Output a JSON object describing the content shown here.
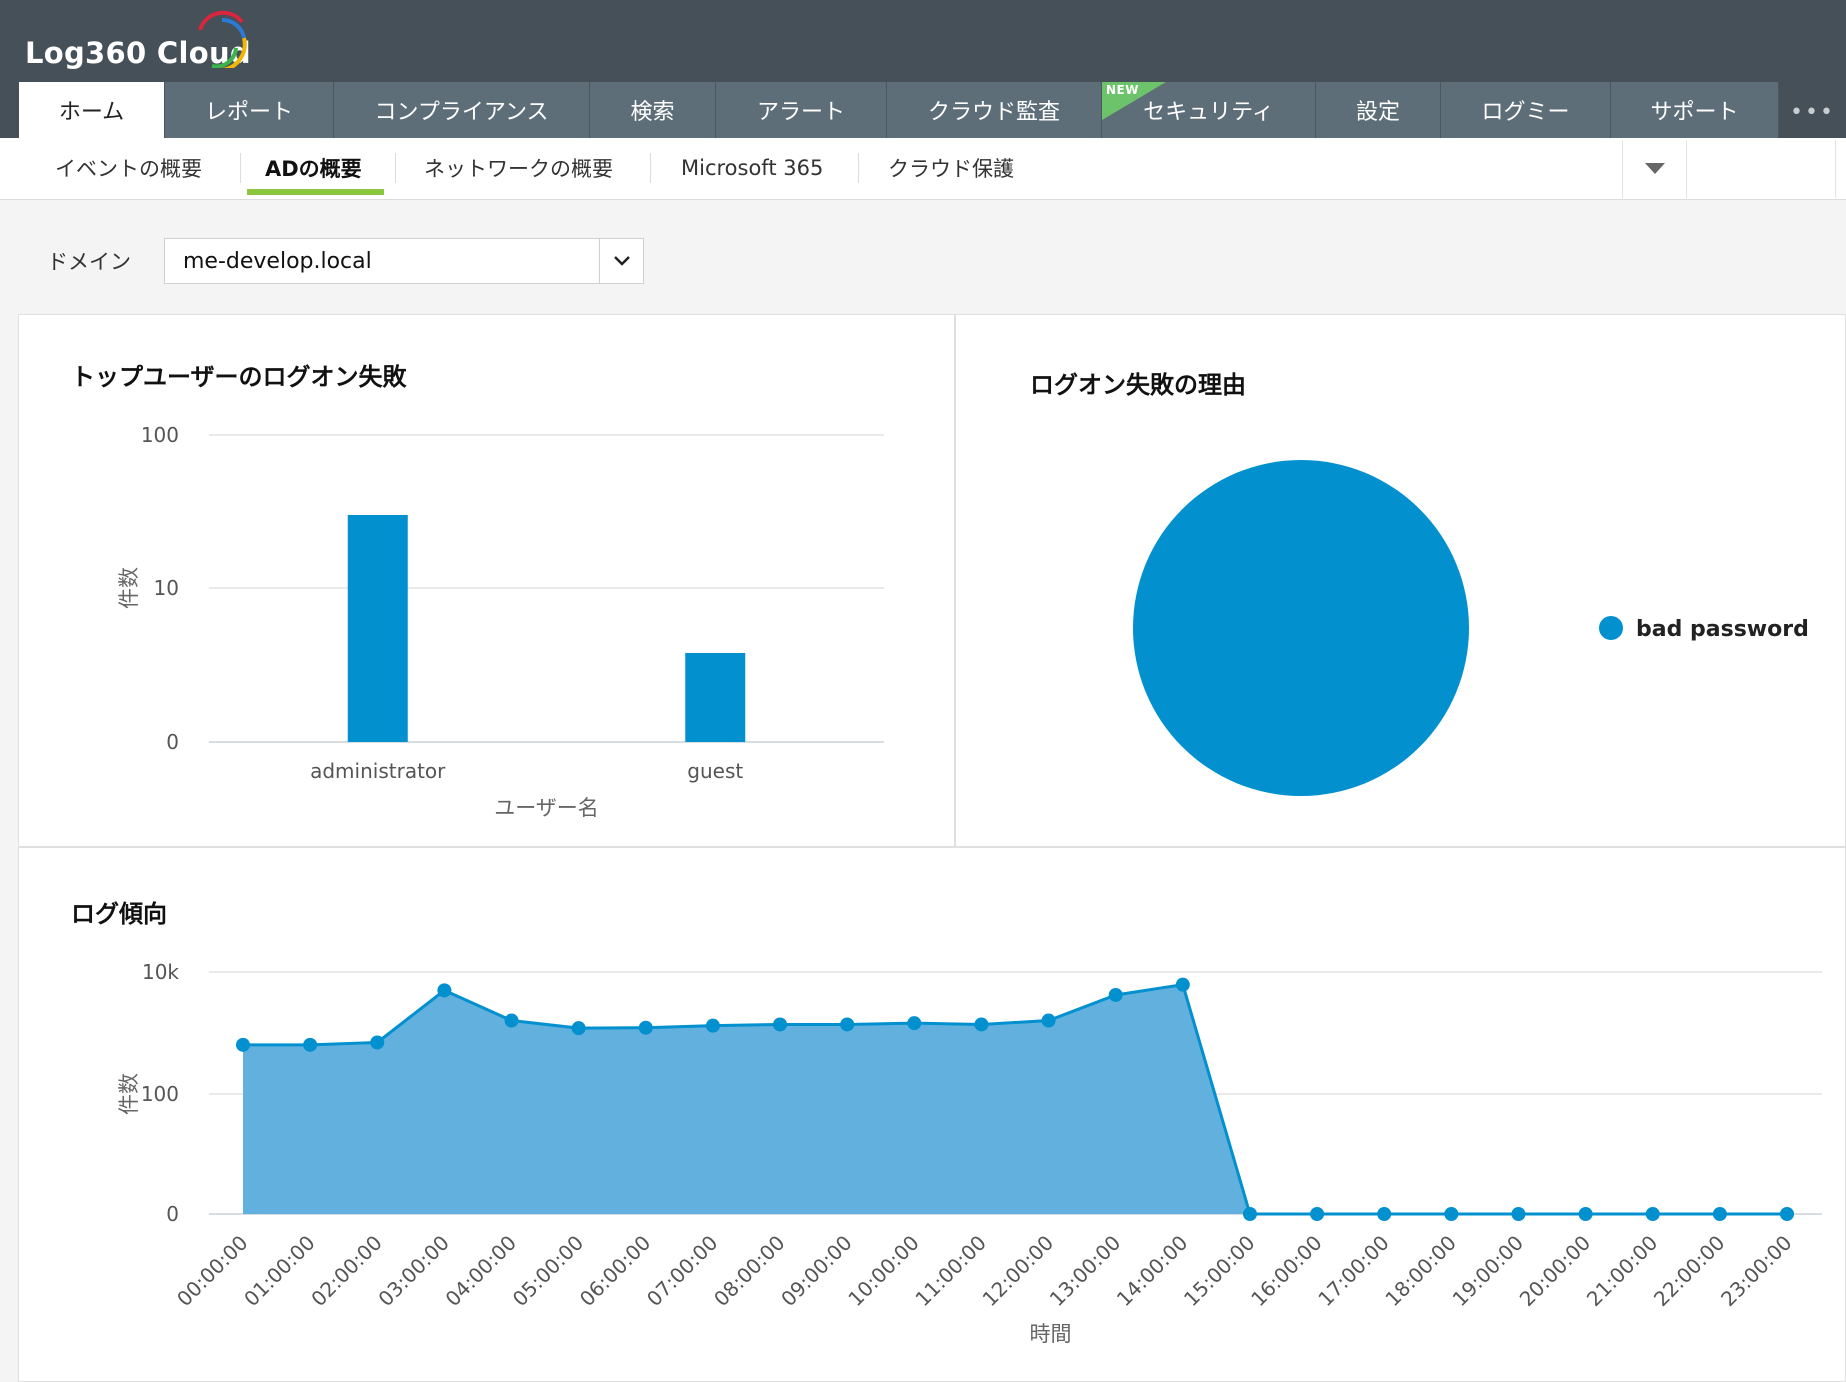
{
  "app": {
    "logo_text": "Log360 Cloud"
  },
  "nav": {
    "tabs": [
      {
        "label": "ホーム",
        "active": true
      },
      {
        "label": "レポート"
      },
      {
        "label": "コンプライアンス"
      },
      {
        "label": "検索"
      },
      {
        "label": "アラート"
      },
      {
        "label": "クラウド監査"
      },
      {
        "label": "セキュリティ",
        "badge": "NEW"
      },
      {
        "label": "設定"
      },
      {
        "label": "ログミー"
      },
      {
        "label": "サポート"
      }
    ],
    "more_icon": "•••"
  },
  "subnav": {
    "items": [
      {
        "label": "イベントの概要"
      },
      {
        "label": "ADの概要",
        "active": true
      },
      {
        "label": "ネットワークの概要"
      },
      {
        "label": "Microsoft 365"
      },
      {
        "label": "クラウド保護"
      }
    ]
  },
  "filter": {
    "label": "ドメイン",
    "value": "me-develop.local"
  },
  "panels": {
    "top_users": {
      "title": "トップユーザーのログオン失敗"
    },
    "reasons": {
      "title": "ログオン失敗の理由"
    },
    "trend": {
      "title": "ログ傾向"
    }
  },
  "colors": {
    "accent": "#0290cf",
    "area_fill": "#5aacdc",
    "tab_bg": "#5e6e79",
    "header_bg": "#455059",
    "active_underline": "#8cc63f",
    "badge_green": "#6cc36a"
  },
  "chart_data": [
    {
      "type": "bar",
      "title": "トップユーザーのログオン失敗",
      "xlabel": "ユーザー名",
      "ylabel": "件数",
      "yscale": "log",
      "yticks": [
        "0",
        "10",
        "100"
      ],
      "categories": [
        "administrator",
        "guest"
      ],
      "values": [
        30,
        3
      ],
      "grid": true
    },
    {
      "type": "pie",
      "title": "ログオン失敗の理由",
      "labels": [
        "bad password"
      ],
      "values": [
        100
      ],
      "legend": "right"
    },
    {
      "type": "area",
      "title": "ログ傾向",
      "xlabel": "時間",
      "ylabel": "件数",
      "yscale": "log",
      "yticks": [
        "0",
        "100",
        "10k"
      ],
      "x": [
        "00:00:00",
        "01:00:00",
        "02:00:00",
        "03:00:00",
        "04:00:00",
        "05:00:00",
        "06:00:00",
        "07:00:00",
        "08:00:00",
        "09:00:00",
        "10:00:00",
        "11:00:00",
        "12:00:00",
        "13:00:00",
        "14:00:00",
        "15:00:00",
        "16:00:00",
        "17:00:00",
        "18:00:00",
        "19:00:00",
        "20:00:00",
        "21:00:00",
        "22:00:00",
        "23:00:00"
      ],
      "values": [
        640,
        640,
        700,
        5000,
        1600,
        1200,
        1220,
        1320,
        1380,
        1380,
        1450,
        1380,
        1600,
        4200,
        6200,
        0,
        0,
        0,
        0,
        0,
        0,
        0,
        0,
        0
      ],
      "grid": true
    }
  ]
}
